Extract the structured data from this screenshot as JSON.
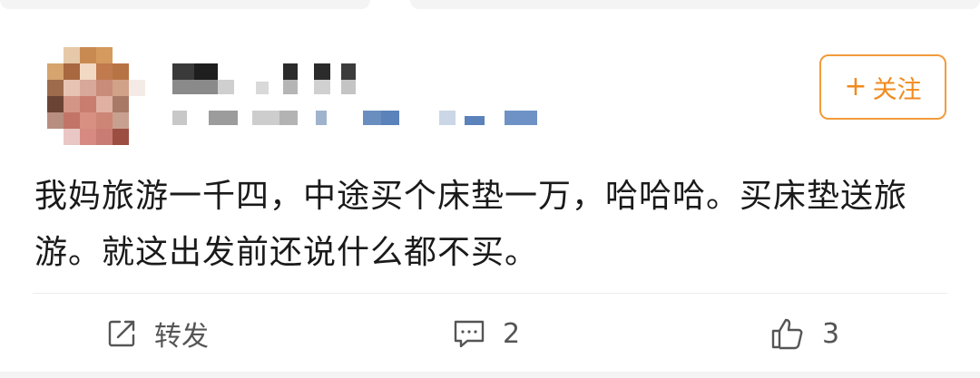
{
  "user": {
    "avatar_icon": "blurred-avatar-icon",
    "name": "",
    "meta": ""
  },
  "follow_button": {
    "plus": "+",
    "label": "关注",
    "color": "#f08a1d"
  },
  "post": {
    "text": "我妈旅游一千四，中途买个床垫一万，哈哈哈。买床垫送旅游。就这出发前还说什么都不买。"
  },
  "actions": {
    "repost": {
      "icon": "share-icon",
      "label": "转发"
    },
    "comment": {
      "icon": "comment-icon",
      "count": "2"
    },
    "like": {
      "icon": "thumbs-up-icon",
      "count": "3"
    }
  },
  "colors": {
    "accent": "#f08a1d",
    "text": "#1a1a1a",
    "secondary": "#555555",
    "divider": "#ececec"
  }
}
